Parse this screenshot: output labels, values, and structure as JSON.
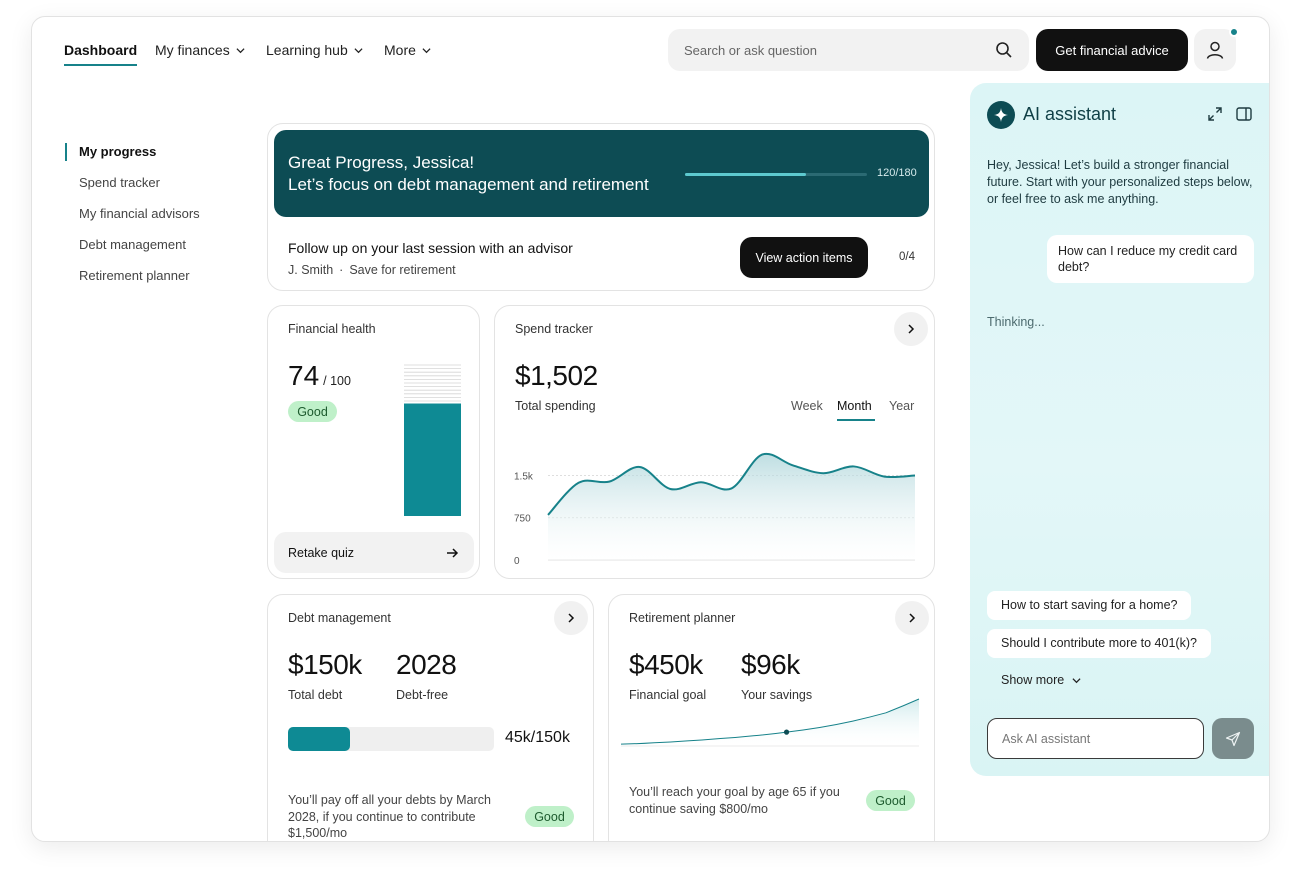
{
  "nav": {
    "items": [
      {
        "label": "Dashboard"
      },
      {
        "label": "My finances"
      },
      {
        "label": "Learning hub"
      },
      {
        "label": "More"
      }
    ],
    "search_placeholder": "Search or ask question",
    "cta_label": "Get financial advice"
  },
  "sidebar": {
    "items": [
      {
        "label": "My progress"
      },
      {
        "label": "Spend tracker"
      },
      {
        "label": "My financial advisors"
      },
      {
        "label": "Debt management"
      },
      {
        "label": "Retirement planner"
      }
    ]
  },
  "progress": {
    "line1": "Great Progress, Jessica!",
    "line2": "Let’s focus on debt management and retirement",
    "value": 120,
    "max": 180,
    "count_label": "120/180",
    "followup_title": "Follow up on your last session with an advisor",
    "followup_advisor": "J. Smith",
    "followup_topic": "Save for retirement",
    "action_label": "View action items",
    "action_count": "0/4"
  },
  "health": {
    "title": "Financial health",
    "score": "74",
    "score_max": "/ 100",
    "score_fraction": 0.74,
    "badge": "Good",
    "retake_label": "Retake quiz"
  },
  "spend": {
    "title": "Spend tracker",
    "amount": "$1,502",
    "amount_label": "Total spending",
    "tabs": [
      "Week",
      "Month",
      "Year"
    ],
    "active_tab": "Month",
    "y_ticks": [
      "1.5k",
      "750",
      "0"
    ]
  },
  "debt": {
    "title": "Debt management",
    "total": "$150k",
    "total_label": "Total debt",
    "year": "2028",
    "year_label": "Debt-free",
    "paid_fraction": 0.3,
    "progress_label": "45k/150k",
    "note": "You’ll pay off all your debts by March 2028, if you continue to contribute $1,500/mo",
    "badge": "Good"
  },
  "retire": {
    "title": "Retirement planner",
    "goal": "$450k",
    "goal_label": "Financial goal",
    "savings": "$96k",
    "savings_label": "Your savings",
    "note": "You’ll reach your goal by age 65 if you continue saving $800/mo",
    "badge": "Good"
  },
  "ai": {
    "title": "AI assistant",
    "intro": "Hey, Jessica! Let’s build a stronger financial future. Start with your personalized steps below, or feel free to ask me anything.",
    "user_message": "How can I reduce my credit card debt?",
    "thinking": "Thinking...",
    "suggestions": [
      "How to start saving for a home?",
      "Should I contribute more to 401(k)?"
    ],
    "show_more": "Show more",
    "input_placeholder": "Ask AI assistant"
  },
  "colors": {
    "accent": "#17828a",
    "hero_bg": "#0d4c54",
    "good_badge": "#bff0c9"
  },
  "chart_data": [
    {
      "type": "area",
      "title": "",
      "x": [
        0,
        1,
        2,
        3,
        4,
        5,
        6,
        7,
        8,
        9,
        10,
        11,
        12
      ],
      "values": [
        800,
        1370,
        1390,
        1650,
        1260,
        1380,
        1270,
        1870,
        1680,
        1540,
        1660,
        1480,
        1500
      ],
      "ylim": [
        0,
        2200
      ],
      "y_ticks": [
        "1.5k",
        "750",
        "0"
      ],
      "grid": true
    },
    {
      "type": "line",
      "title": "",
      "series": [
        {
          "values": [
            0.02,
            0.05,
            0.09,
            0.14,
            0.2,
            0.28,
            0.38,
            0.52,
            0.7,
            1.0
          ]
        }
      ],
      "marker_index": 5
    }
  ]
}
